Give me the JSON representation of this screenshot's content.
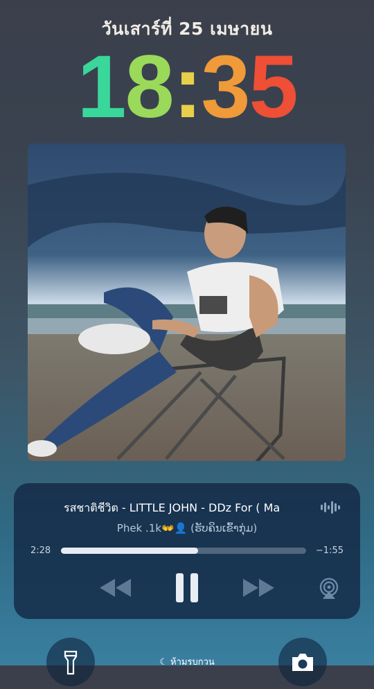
{
  "lockscreen": {
    "date": "วันเสาร์ที่ 25 เมษายน",
    "time_digits": [
      "1",
      "8",
      ":",
      "3",
      "5"
    ],
    "time_colors": [
      "#3ad79b",
      "#9ad95a",
      "#e8cf4a",
      "#f09a3a",
      "#ee4f35"
    ]
  },
  "player": {
    "title": "รสชาติชีวิต - LITTLE JOHN - DDz For ( Ma",
    "artist": "Phe​k .1k👐👤 (ຮັບຄິນເຂົ້າກຸ່ມ)",
    "elapsed": "2:28",
    "remaining": "−1:55",
    "progress": 0.56
  },
  "dnd_label": "ห้ามรบกวน"
}
